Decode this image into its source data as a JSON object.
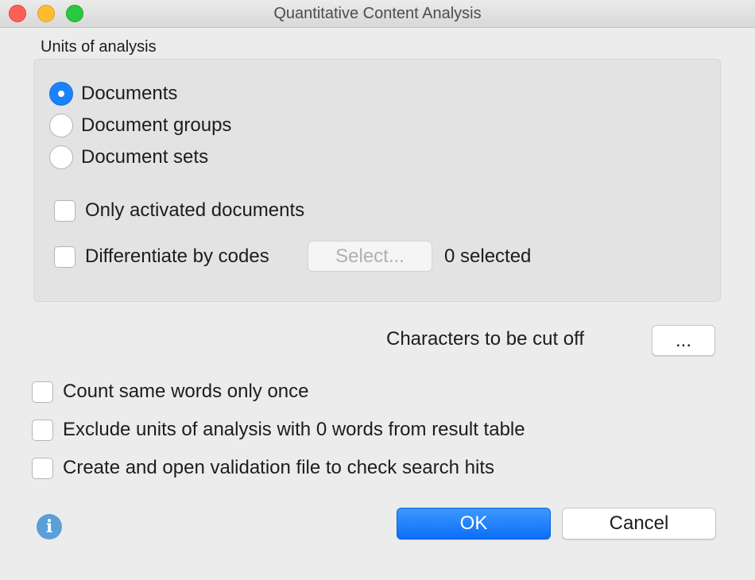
{
  "window": {
    "title": "Quantitative Content Analysis",
    "controls": [
      "close-icon",
      "minimize-icon",
      "zoom-icon"
    ]
  },
  "units": {
    "label": "Units of analysis",
    "options": [
      {
        "label": "Documents",
        "selected": true
      },
      {
        "label": "Document groups",
        "selected": false
      },
      {
        "label": "Document sets",
        "selected": false
      }
    ],
    "only_activated": {
      "label": "Only activated documents",
      "checked": false
    },
    "differentiate": {
      "label": "Differentiate by codes",
      "checked": false,
      "select_button": "Select...",
      "selected_count": "0 selected"
    }
  },
  "cutoff": {
    "label": "Characters to be cut off",
    "button": "..."
  },
  "options": [
    {
      "label": "Count same words only once",
      "checked": false
    },
    {
      "label": "Exclude units of analysis with 0 words from result table",
      "checked": false
    },
    {
      "label": "Create and open validation file to check search hits",
      "checked": false
    }
  ],
  "buttons": {
    "ok": "OK",
    "cancel": "Cancel"
  },
  "info_icon": {
    "glyph": "i",
    "color": "#5a9fd8"
  },
  "colors": {
    "accent": "#1a82fb",
    "background": "#ececec"
  }
}
